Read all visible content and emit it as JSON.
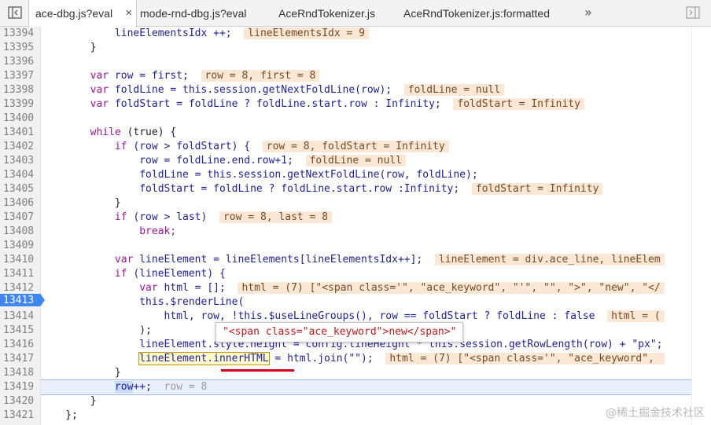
{
  "tabs": [
    {
      "label": "ace-dbg.js?eval",
      "active": true,
      "close": "×"
    },
    {
      "label": "mode-rnd-dbg.js?eval",
      "active": false
    },
    {
      "label": "AceRndTokenizer.js",
      "active": false
    },
    {
      "label": "AceRndTokenizer.js:formatted",
      "active": false
    }
  ],
  "more_tabs": "»",
  "icons": {
    "toggle_navigator": "sidebar-left-icon",
    "toggle_debugger": "sidebar-right-icon"
  },
  "line_numbers": [
    "13394",
    "13395",
    "13396",
    "13397",
    "13398",
    "13399",
    "13400",
    "13401",
    "13402",
    "13403",
    "13404",
    "13405",
    "13406",
    "13407",
    "13408",
    "13409",
    "13410",
    "13411",
    "13412",
    "13413",
    "13414",
    "13415",
    "13416",
    "13417",
    "13418",
    "13419",
    "13420",
    "13421"
  ],
  "breakpoint_line": "13413",
  "code": {
    "l13394": {
      "a": "            lineElementsIdx ++;",
      "v": "lineElementsIdx = 9"
    },
    "l13395": "        }",
    "l13397": {
      "a": "        var ",
      "b": "row = first;",
      "v": "row = 8, first = 8"
    },
    "l13398": {
      "a": "        var ",
      "b": "foldLine = this.session.getNextFoldLine(row);",
      "v": "foldLine = null"
    },
    "l13399": {
      "a": "        var ",
      "b": "foldStart = foldLine ? foldLine.start.row : Infinity;",
      "v": "foldStart = Infinity"
    },
    "l13401": {
      "a": "        while ",
      "b": "(true) {"
    },
    "l13402": {
      "a": "            if ",
      "b": "(row > foldStart) {",
      "v": "row = 8, foldStart = Infinity"
    },
    "l13403": {
      "a": "                row = foldLine.end.row+1;",
      "v": "foldLine = null"
    },
    "l13404": "                foldLine = this.session.getNextFoldLine(row, foldLine);",
    "l13405": {
      "a": "                foldStart = foldLine ? foldLine.start.row :Infinity;",
      "v": "foldStart = Infinity"
    },
    "l13406": "            }",
    "l13407": {
      "a": "            if ",
      "b": "(row > last)",
      "v": "row = 8, last = 8"
    },
    "l13408": "                break;",
    "l13410": {
      "a": "            var ",
      "b": "lineElement = lineElements[lineElementsIdx++];",
      "v": "lineElement = div.ace_line, lineElem"
    },
    "l13411": {
      "a": "            if ",
      "b": "(lineElement) {"
    },
    "l13412": {
      "a": "                var ",
      "b": "html = [];",
      "v": "html = (7) [\"<span class='\", \"ace_keyword\", \"'\", \"\", \">\", \"new\", \"</"
    },
    "l13413": "                this.$renderLine(",
    "l13414": {
      "a": "                    html, row, !this.$useLineGroups(), row == foldStart ? foldLine : false",
      "v": "html = ("
    },
    "l13415": "                );",
    "l13416": "                lineElement.style.height = config.lineHeight * this.session.getRowLength(row) + \"px\";",
    "l13417": {
      "sel": "lineElement.innerHTML",
      "a": " = html.join(\"\");",
      "v": "html = (7) [\"<span class='\", \"ace_keyword\", "
    },
    "l13418": "            }",
    "l13419": {
      "w": "row",
      "a": "++;",
      "v": "row = 8"
    },
    "l13420": "        }",
    "l13421": "    };"
  },
  "tooltip": "\"<span class=\"ace_keyword\">new</span>\"",
  "watermark": "@稀土掘金技术社区"
}
